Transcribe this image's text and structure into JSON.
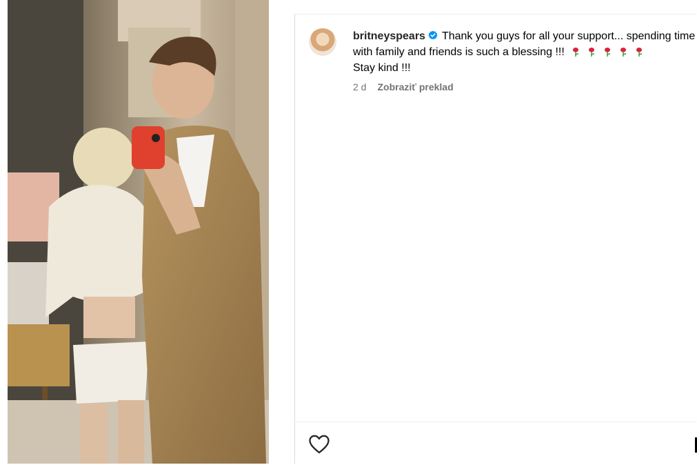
{
  "post": {
    "username": "britneyspears",
    "verified": true,
    "caption_main": "Thank you guys for all your support... spending time with family and friends is such a blessing !!!",
    "caption_end": "Stay kind !!!",
    "emoji_count": 5,
    "emoji": "rose",
    "time_ago": "2 d",
    "translate_label": "Zobraziť preklad"
  },
  "icons": {
    "like": "heart-icon",
    "verified": "verified-badge-icon",
    "save": "bookmark-icon"
  },
  "colors": {
    "verified_blue": "#0095f6",
    "meta_gray": "#737373",
    "divider": "#efefef"
  }
}
